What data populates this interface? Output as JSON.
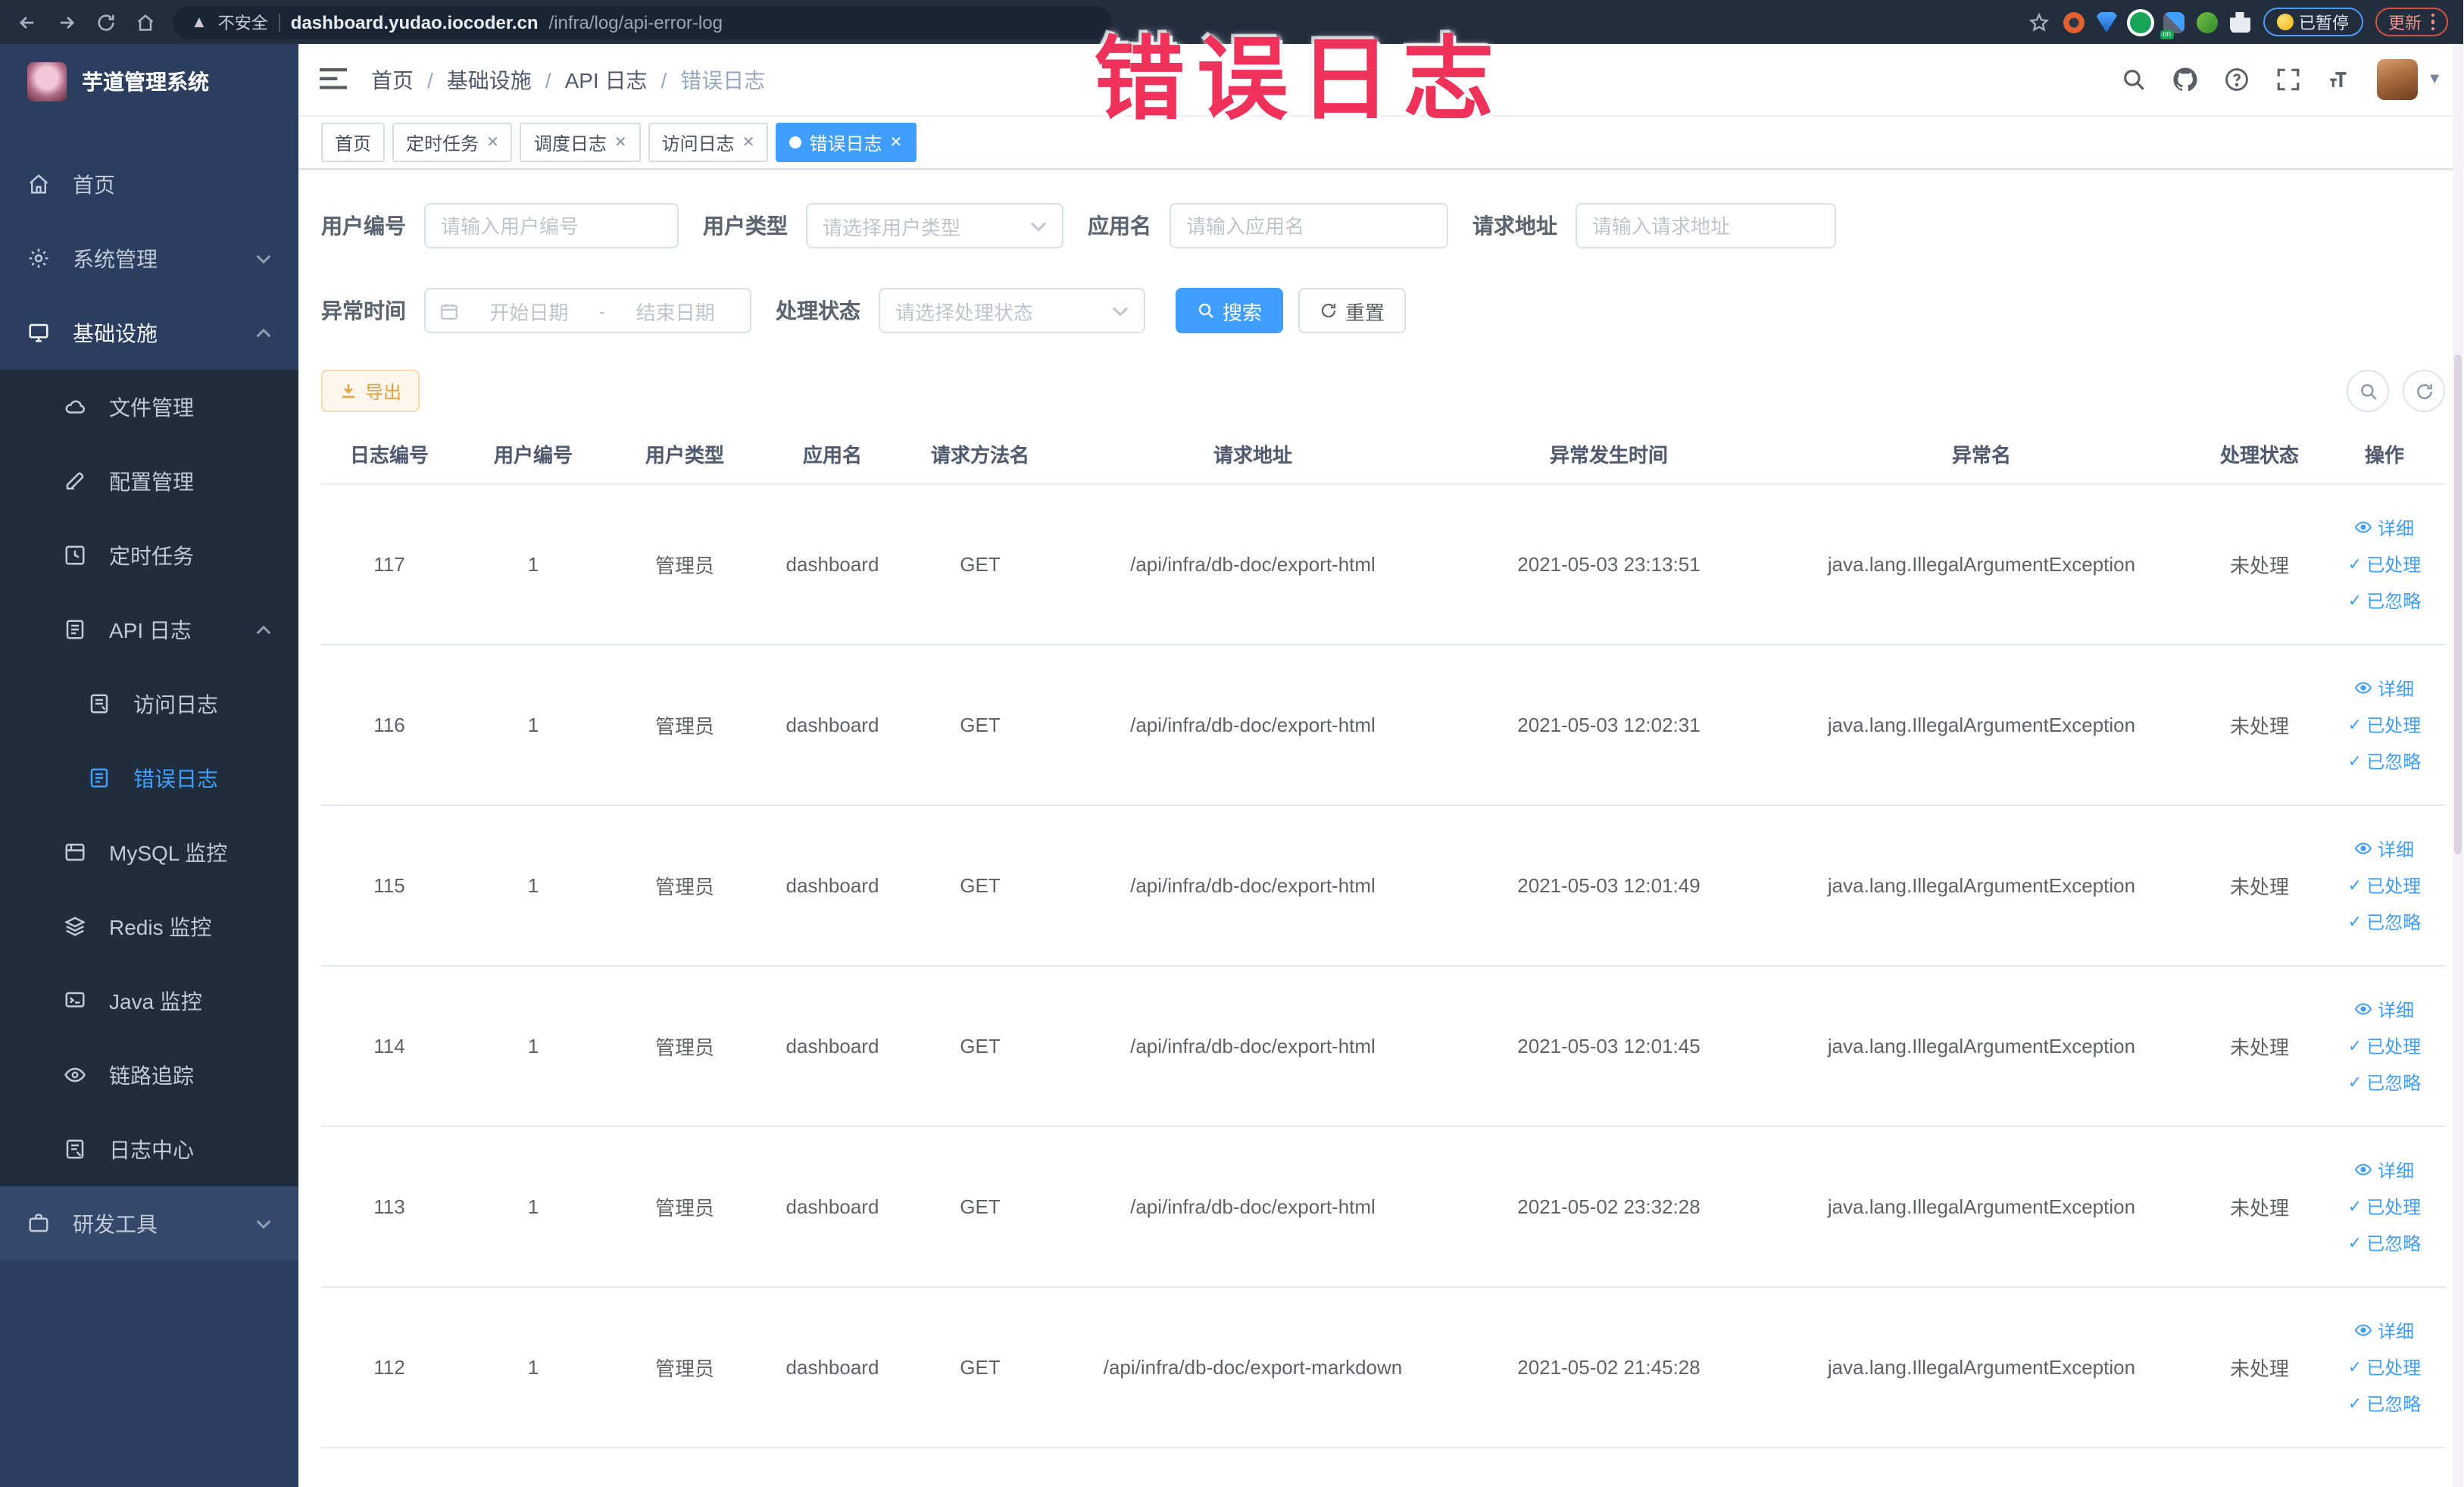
{
  "browser": {
    "security_label": "不安全",
    "url_host": "dashboard.yudao.iocoder.cn",
    "url_path": "/infra/log/api-error-log",
    "paused_badge": "已暂停",
    "update_badge": "更新"
  },
  "watermark": {
    "text": "错误日志",
    "color": "#f0315a"
  },
  "sidebar": {
    "title": "芋道管理系统",
    "items": [
      {
        "label": "首页"
      },
      {
        "label": "系统管理"
      },
      {
        "label": "基础设施"
      },
      {
        "label": "文件管理"
      },
      {
        "label": "配置管理"
      },
      {
        "label": "定时任务"
      },
      {
        "label": "API 日志"
      },
      {
        "label": "访问日志"
      },
      {
        "label": "错误日志"
      },
      {
        "label": "MySQL 监控"
      },
      {
        "label": "Redis 监控"
      },
      {
        "label": "Java 监控"
      },
      {
        "label": "链路追踪"
      },
      {
        "label": "日志中心"
      },
      {
        "label": "研发工具"
      }
    ]
  },
  "breadcrumb": {
    "items": [
      "首页",
      "基础设施",
      "API 日志",
      "错误日志"
    ],
    "separator": "/"
  },
  "tabs": [
    {
      "label": "首页"
    },
    {
      "label": "定时任务"
    },
    {
      "label": "调度日志"
    },
    {
      "label": "访问日志"
    },
    {
      "label": "错误日志"
    }
  ],
  "filters": {
    "user_id": {
      "label": "用户编号",
      "placeholder": "请输入用户编号"
    },
    "user_type": {
      "label": "用户类型",
      "placeholder": "请选择用户类型"
    },
    "app_name": {
      "label": "应用名",
      "placeholder": "请输入应用名"
    },
    "request_url": {
      "label": "请求地址",
      "placeholder": "请输入请求地址"
    },
    "exception_time": {
      "label": "异常时间",
      "start_placeholder": "开始日期",
      "separator": "-",
      "end_placeholder": "结束日期"
    },
    "process_status": {
      "label": "处理状态",
      "placeholder": "请选择处理状态"
    },
    "search_label": "搜索",
    "reset_label": "重置"
  },
  "toolbar": {
    "export_label": "导出"
  },
  "table": {
    "columns": [
      "日志编号",
      "用户编号",
      "用户类型",
      "应用名",
      "请求方法名",
      "请求地址",
      "异常发生时间",
      "异常名",
      "处理状态",
      "操作"
    ],
    "actions": [
      "详细",
      "已处理",
      "已忽略"
    ],
    "rows": [
      {
        "id": "117",
        "user_id": "1",
        "user_type": "管理员",
        "app_name": "dashboard",
        "method": "GET",
        "url": "/api/infra/db-doc/export-html",
        "time": "2021-05-03 23:13:51",
        "exception": "java.lang.IllegalArgumentException",
        "status": "未处理"
      },
      {
        "id": "116",
        "user_id": "1",
        "user_type": "管理员",
        "app_name": "dashboard",
        "method": "GET",
        "url": "/api/infra/db-doc/export-html",
        "time": "2021-05-03 12:02:31",
        "exception": "java.lang.IllegalArgumentException",
        "status": "未处理"
      },
      {
        "id": "115",
        "user_id": "1",
        "user_type": "管理员",
        "app_name": "dashboard",
        "method": "GET",
        "url": "/api/infra/db-doc/export-html",
        "time": "2021-05-03 12:01:49",
        "exception": "java.lang.IllegalArgumentException",
        "status": "未处理"
      },
      {
        "id": "114",
        "user_id": "1",
        "user_type": "管理员",
        "app_name": "dashboard",
        "method": "GET",
        "url": "/api/infra/db-doc/export-html",
        "time": "2021-05-03 12:01:45",
        "exception": "java.lang.IllegalArgumentException",
        "status": "未处理"
      },
      {
        "id": "113",
        "user_id": "1",
        "user_type": "管理员",
        "app_name": "dashboard",
        "method": "GET",
        "url": "/api/infra/db-doc/export-html",
        "time": "2021-05-02 23:32:28",
        "exception": "java.lang.IllegalArgumentException",
        "status": "未处理"
      },
      {
        "id": "112",
        "user_id": "1",
        "user_type": "管理员",
        "app_name": "dashboard",
        "method": "GET",
        "url": "/api/infra/db-doc/export-markdown",
        "time": "2021-05-02 21:45:28",
        "exception": "java.lang.IllegalArgumentException",
        "status": "未处理"
      }
    ]
  }
}
